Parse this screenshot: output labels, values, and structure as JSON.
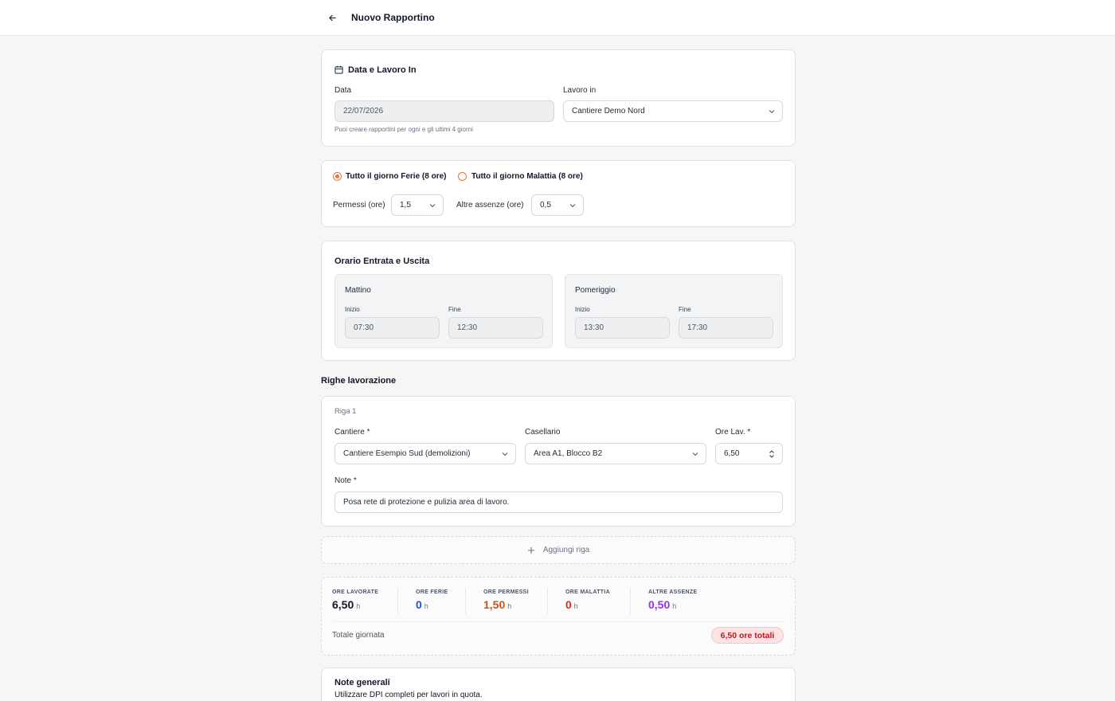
{
  "header": {
    "title": "Nuovo Rapportino"
  },
  "date_section": {
    "title": "Data e Lavoro In",
    "date_label": "Data",
    "date_value": "22/07/2026",
    "date_hint": "Puoi creare rapportini per ogni e gli ultimi 4 giorni",
    "work_label": "Lavoro in",
    "work_value": "Cantiere Demo Nord"
  },
  "absence": {
    "ferie_label": "Tutto il giorno Ferie (8 ore)",
    "malattia_label": "Tutto il giorno Malattia (8 ore)",
    "permessi_label": "Permessi (ore)",
    "permessi_value": "1,5",
    "altre_label": "Altre assenze (ore)",
    "altre_value": "0,5"
  },
  "schedule": {
    "title": "Orario Entrata e Uscita",
    "morning": {
      "title": "Mattino",
      "start_label": "Inizio",
      "start": "07:30",
      "end_label": "Fine",
      "end": "12:30"
    },
    "afternoon": {
      "title": "Pomeriggio",
      "start_label": "Inizio",
      "start": "13:30",
      "end_label": "Fine",
      "end": "17:30"
    }
  },
  "rows": {
    "section_title": "Righe lavorazione",
    "row1": {
      "title": "Riga 1",
      "cantiere_label": "Cantiere *",
      "cantiere_value": "Cantiere Esempio Sud (demolizioni)",
      "casellario_label": "Casellario",
      "casellario_value": "Area A1, Blocco B2",
      "ore_label": "Ore Lav. *",
      "ore_value": "6,50",
      "note_label": "Note *",
      "note_value": "Posa rete di protezione e pulizia area di lavoro."
    },
    "add_row_label": "Aggiungi riga"
  },
  "summary": {
    "lavorate": {
      "label": "ORE LAVORATE",
      "value": "6,50",
      "unit": "h",
      "color": "#111827"
    },
    "ferie": {
      "label": "ORE FERIE",
      "value": "0",
      "unit": "h",
      "color": "#1d4ed8"
    },
    "permessi": {
      "label": "ORE PERMESSI",
      "value": "1,50",
      "unit": "h",
      "color": "#c2571a"
    },
    "malattia": {
      "label": "ORE MALATTIA",
      "value": "0",
      "unit": "h",
      "color": "#dc2626"
    },
    "altre": {
      "label": "ALTRE ASSENZE",
      "value": "0,50",
      "unit": "h",
      "color": "#9333ea"
    },
    "total_label": "Totale giornata",
    "total_badge": "6,50 ore totali"
  },
  "general_notes": {
    "title": "Note generali",
    "text": "Utilizzare DPI completi per lavori in quota."
  }
}
